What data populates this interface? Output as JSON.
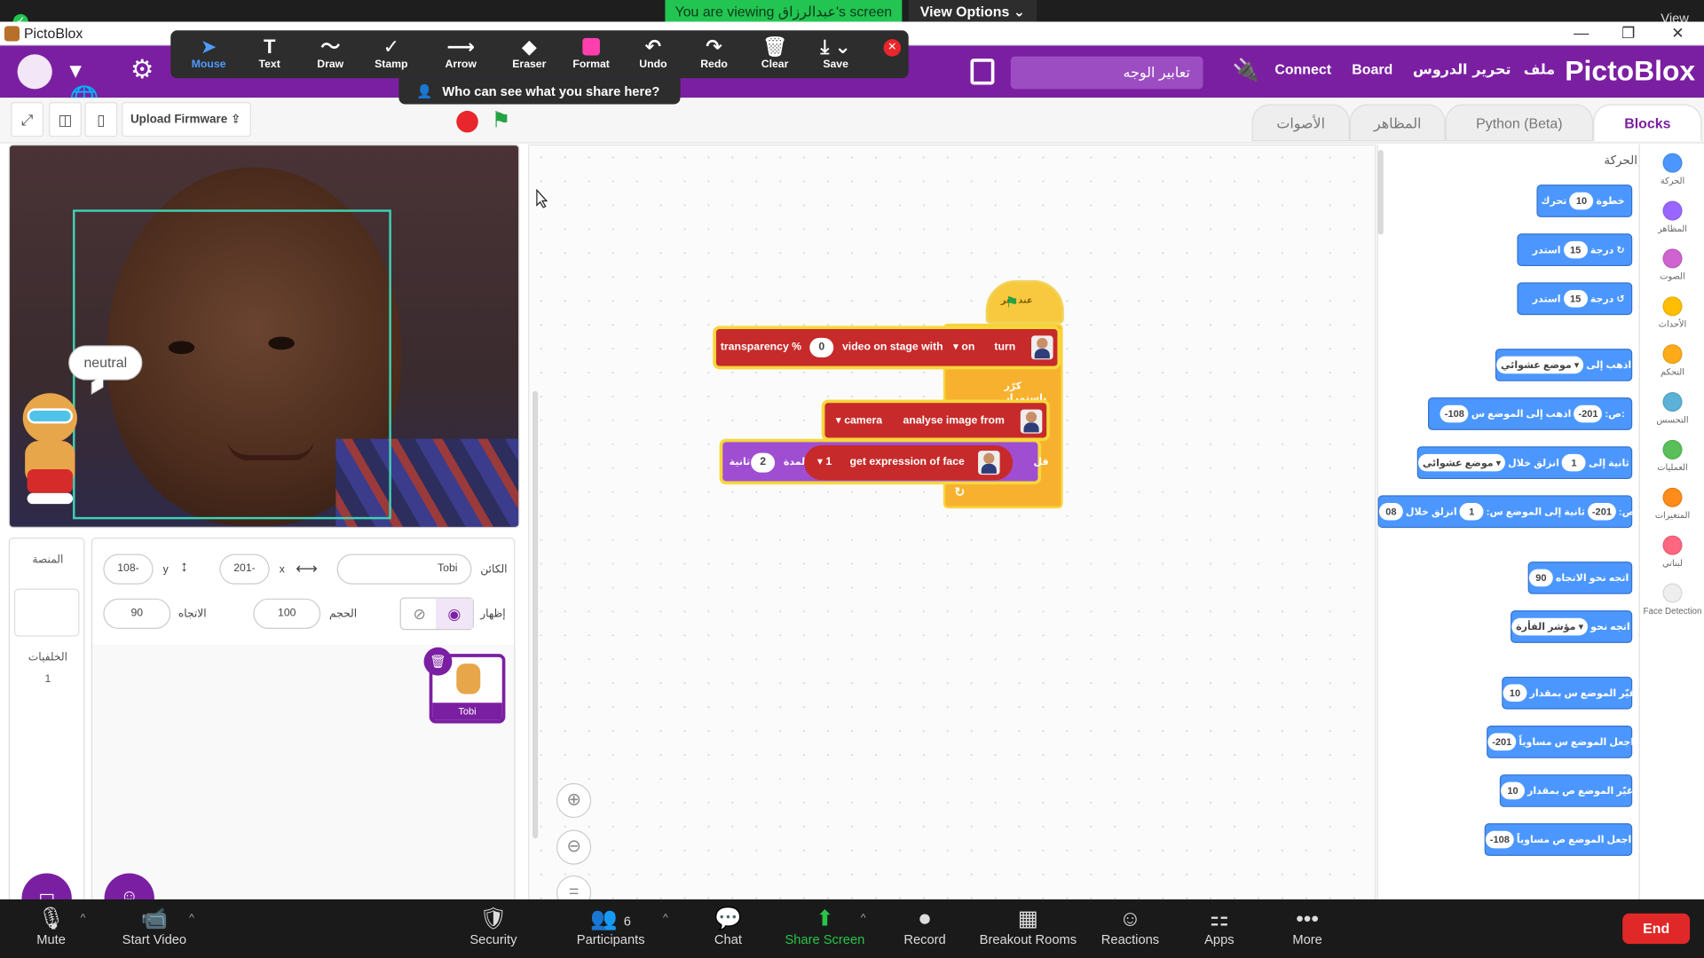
{
  "zoom_top": {
    "viewing_banner": "You are viewing عبدالرزاق's screen",
    "view_options": "View Options ⌄",
    "view_label": "View"
  },
  "window": {
    "title": "PictoBlox",
    "controls": [
      "—",
      "❐",
      "✕"
    ]
  },
  "annotation_toolbar": {
    "tools": [
      {
        "label": "Mouse",
        "icon": "cursor-icon",
        "glyph": "➤"
      },
      {
        "label": "Text",
        "icon": "text-icon",
        "glyph": "T"
      },
      {
        "label": "Draw",
        "icon": "draw-icon",
        "glyph": "〜"
      },
      {
        "label": "Stamp",
        "icon": "stamp-icon",
        "glyph": "✓"
      },
      {
        "label": "Arrow",
        "icon": "arrow-icon",
        "glyph": "⟶"
      },
      {
        "label": "Eraser",
        "icon": "eraser-icon",
        "glyph": "◆"
      },
      {
        "label": "Format",
        "icon": "format-icon",
        "glyph": ""
      },
      {
        "label": "Undo",
        "icon": "undo-icon",
        "glyph": "↶"
      },
      {
        "label": "Redo",
        "icon": "redo-icon",
        "glyph": "↷"
      },
      {
        "label": "Clear",
        "icon": "trash-icon",
        "glyph": "🗑"
      },
      {
        "label": "Save",
        "icon": "download-icon",
        "glyph": "⤓ ⌄"
      }
    ],
    "who_can_see": "Who can see what you share here?",
    "close_glyph": "✕",
    "format_color": "#ff3fae"
  },
  "header": {
    "logo": "PictoBlox",
    "menu": [
      "Connect",
      "Board",
      "الدروس",
      "تحرير",
      "ملف"
    ],
    "project_name": "تعابير الوجه",
    "brand_color": "#7b1fa2",
    "globe_glyph": "▾🌐",
    "gear_glyph": "⚙",
    "connect_glyph": "🔌"
  },
  "toolrow": {
    "upload_firmware": "Upload Firmware ⇪",
    "fullscreen_glyph": "⤢",
    "layout1_glyph": "◫",
    "layout2_glyph": "▯",
    "flag_glyph": "⚑",
    "tabs": [
      "Blocks",
      "Python (Beta)",
      "المظاهر",
      "الأصوات"
    ]
  },
  "stage": {
    "speech_bubble": "neutral"
  },
  "sprite_info": {
    "sprite_label": "الكائن",
    "sprite_name": "Tobi",
    "x_label": "x",
    "x_value": "201-",
    "y_label": "y",
    "y_value": "108-",
    "show_label": "إظهار",
    "size_label": "الحجم",
    "size_value": "100",
    "direction_label": "الاتجاه",
    "direction_value": "90"
  },
  "backdrop_panel": {
    "stage_label": "المنصة",
    "backdrops_label": "الخلفيات",
    "backdrops_count": "1"
  },
  "sprites": [
    {
      "name": "Tobi"
    }
  ],
  "code_blocks": {
    "when_flag": "عند نقر",
    "transparency": {
      "label": "transparency %",
      "value": "0",
      "mid": "video on stage with",
      "dropdown": "▾ on",
      "end": "turn"
    },
    "forever": "كرّر باستمرار",
    "camera": {
      "dropdown": "▾ camera",
      "label": "analyse image from"
    },
    "say": {
      "pre": "قل",
      "for_label": "لمدة",
      "secs": "2",
      "secs_label": "ثانية"
    },
    "expression": {
      "dropdown": "▾ 1",
      "label": "get expression of face"
    },
    "loop_arrow": "↻"
  },
  "palette": {
    "title": "الحركة",
    "blocks": [
      {
        "pre": "تحرك",
        "value": "10",
        "post": "خطوة"
      },
      {
        "pre": "استدر ↻",
        "value": "15",
        "post": "درجة"
      },
      {
        "pre": "استدر ↺",
        "value": "15",
        "post": "درجة"
      },
      {
        "pre": "اذهب إلى",
        "value": "موضع عشوائي ▾",
        "post": ""
      },
      {
        "pre": "اذهب إلى الموضع س:",
        "value": "-201",
        "post": "ص:",
        "value2": "-108"
      },
      {
        "pre": "انزلق خلال",
        "value": "1",
        "post": "ثانية إلى",
        "value2": "موضع عشوائي ▾"
      },
      {
        "pre": "انزلق خلال",
        "value": "1",
        "post": "ثانية إلى الموضع س:",
        "value2": "-201",
        "post2": "ص:",
        "value3": "08"
      },
      {
        "pre": "اتجه نحو الاتجاه",
        "value": "90",
        "post": ""
      },
      {
        "pre": "اتجه نحو",
        "value": "مؤشر الفأرة ▾",
        "post": ""
      },
      {
        "pre": "غيّر الموضع س بمقدار",
        "value": "10",
        "post": ""
      },
      {
        "pre": "اجعل الموضع س مساوياً",
        "value": "-201",
        "post": ""
      },
      {
        "pre": "غيّر الموضع ص بمقدار",
        "value": "10",
        "post": ""
      },
      {
        "pre": "اجعل الموضع ص مساوياً",
        "value": "-108",
        "post": ""
      }
    ]
  },
  "categories": [
    {
      "label": "الحركة",
      "color": "#4c97ff"
    },
    {
      "label": "المظاهر",
      "color": "#9966ff"
    },
    {
      "label": "الصوت",
      "color": "#cf63cf"
    },
    {
      "label": "الأحداث",
      "color": "#ffbf00"
    },
    {
      "label": "التحكم",
      "color": "#ffab19"
    },
    {
      "label": "التحسس",
      "color": "#5cb1d6"
    },
    {
      "label": "العمليات",
      "color": "#59c059"
    },
    {
      "label": "المتغيرات",
      "color": "#ff8c1a"
    },
    {
      "label": "لبناتي",
      "color": "#ff6680"
    },
    {
      "label": "Face Detection",
      "color": "#eeeeee"
    }
  ],
  "zoom_bottom": {
    "items": [
      {
        "label": "Mute",
        "icon": "microphone-icon",
        "glyph": "🎙"
      },
      {
        "label": "Start Video",
        "icon": "video-off-icon",
        "glyph": "📹"
      },
      {
        "label": "Security",
        "icon": "shield-icon",
        "glyph": "🛡"
      },
      {
        "label": "Participants",
        "icon": "participants-icon",
        "glyph": "👥",
        "count": "6"
      },
      {
        "label": "Chat",
        "icon": "chat-icon",
        "glyph": "💬"
      },
      {
        "label": "Share Screen",
        "icon": "share-screen-icon",
        "glyph": "⬆"
      },
      {
        "label": "Record",
        "icon": "record-icon",
        "glyph": "⏺"
      },
      {
        "label": "Breakout Rooms",
        "icon": "breakout-rooms-icon",
        "glyph": "▦"
      },
      {
        "label": "Reactions",
        "icon": "reactions-icon",
        "glyph": "☺"
      },
      {
        "label": "Apps",
        "icon": "apps-icon",
        "glyph": "⚏"
      },
      {
        "label": "More",
        "icon": "more-icon",
        "glyph": "•••"
      }
    ],
    "end_label": "End",
    "caret": "^"
  }
}
